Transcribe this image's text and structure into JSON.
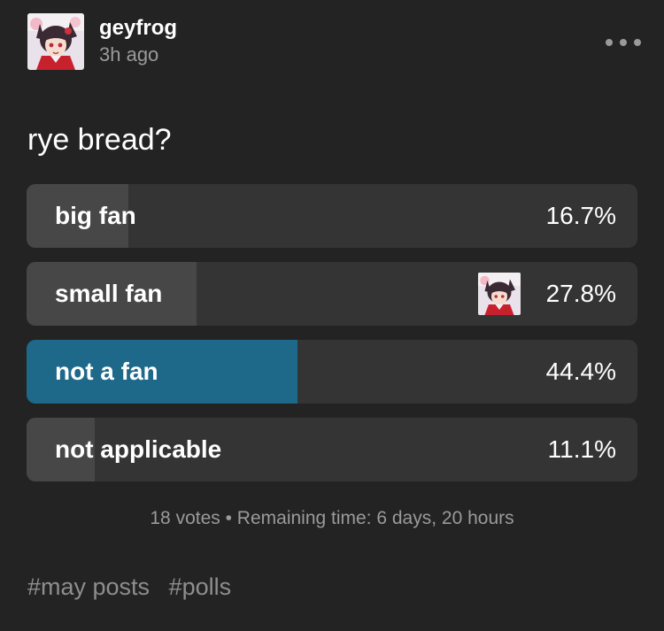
{
  "post": {
    "author": "geyfrog",
    "time_ago": "3h ago",
    "more_icon": "more-horizontal-icon",
    "question": "rye bread?",
    "options": [
      {
        "label": "big fan",
        "percent": "16.7%",
        "fraction": 0.167,
        "selected": false
      },
      {
        "label": "small fan",
        "percent": "27.8%",
        "fraction": 0.278,
        "selected": false,
        "voter_avatar": true
      },
      {
        "label": "not a fan",
        "percent": "44.4%",
        "fraction": 0.444,
        "selected": true
      },
      {
        "label": "not applicable",
        "percent": "11.1%",
        "fraction": 0.111,
        "selected": false
      }
    ],
    "votes": "18 votes",
    "remaining": "Remaining time: 6 days, 20 hours",
    "tags": [
      "#may posts",
      "#polls"
    ],
    "colors": {
      "background": "#232323",
      "option_bg": "#343434",
      "option_fill": "#474747",
      "selected_fill": "#1e6889"
    }
  }
}
